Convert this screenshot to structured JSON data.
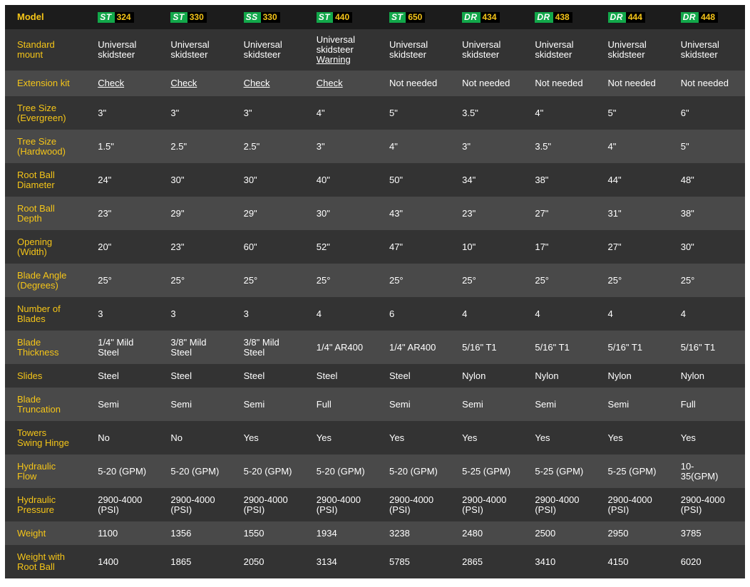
{
  "header_label": "Model",
  "models": [
    {
      "series": "ST",
      "number": "324"
    },
    {
      "series": "ST",
      "number": "330"
    },
    {
      "series": "SS",
      "number": "330"
    },
    {
      "series": "ST",
      "number": "440"
    },
    {
      "series": "ST",
      "number": "650"
    },
    {
      "series": "DR",
      "number": "434"
    },
    {
      "series": "DR",
      "number": "438"
    },
    {
      "series": "DR",
      "number": "444"
    },
    {
      "series": "DR",
      "number": "448"
    }
  ],
  "colors": {
    "accent_yellow": "#f5c518",
    "series_green": "#12a84a",
    "header_bg": "#1c1c1c",
    "row_dark": "#333333",
    "row_light": "#494949"
  },
  "rows": [
    {
      "label": [
        "Standard",
        "mount"
      ],
      "height": 58,
      "cells": [
        {
          "lines": [
            "Universal",
            "skidsteer"
          ]
        },
        {
          "lines": [
            "Universal",
            "skidsteer"
          ]
        },
        {
          "lines": [
            "Universal",
            "skidsteer"
          ]
        },
        {
          "lines": [
            "Universal",
            "skidsteer"
          ],
          "link": "Warning"
        },
        {
          "lines": [
            "Universal",
            "skidsteer"
          ]
        },
        {
          "lines": [
            "Universal",
            "skidsteer"
          ]
        },
        {
          "lines": [
            "Universal",
            "skidsteer"
          ]
        },
        {
          "lines": [
            "Universal",
            "skidsteer"
          ]
        },
        {
          "lines": [
            "Universal",
            "skidsteer"
          ]
        }
      ]
    },
    {
      "label": [
        "Extension kit"
      ],
      "height": 36,
      "cells": [
        {
          "link": "Check"
        },
        {
          "link": "Check"
        },
        {
          "link": "Check"
        },
        {
          "link": "Check"
        },
        {
          "lines": [
            "Not needed"
          ]
        },
        {
          "lines": [
            "Not needed"
          ]
        },
        {
          "lines": [
            "Not needed"
          ]
        },
        {
          "lines": [
            "Not needed"
          ]
        },
        {
          "lines": [
            "Not needed"
          ]
        }
      ]
    },
    {
      "label": [
        "Tree Size",
        "(Evergreen)"
      ],
      "height": 47,
      "cells": [
        {
          "lines": [
            "3\""
          ]
        },
        {
          "lines": [
            "3\""
          ]
        },
        {
          "lines": [
            "3\""
          ]
        },
        {
          "lines": [
            "4\""
          ]
        },
        {
          "lines": [
            "5\""
          ]
        },
        {
          "lines": [
            "3.5\""
          ]
        },
        {
          "lines": [
            "4\""
          ]
        },
        {
          "lines": [
            "5\""
          ]
        },
        {
          "lines": [
            "6\""
          ]
        }
      ]
    },
    {
      "label": [
        "Tree Size",
        "(Hardwood)"
      ],
      "height": 47,
      "cells": [
        {
          "lines": [
            "1.5\""
          ]
        },
        {
          "lines": [
            "2.5\""
          ]
        },
        {
          "lines": [
            "2.5\""
          ]
        },
        {
          "lines": [
            "3\""
          ]
        },
        {
          "lines": [
            "4\""
          ]
        },
        {
          "lines": [
            "3\""
          ]
        },
        {
          "lines": [
            "3.5\""
          ]
        },
        {
          "lines": [
            "4\""
          ]
        },
        {
          "lines": [
            "5\""
          ]
        }
      ]
    },
    {
      "label": [
        "Root Ball",
        "Diameter"
      ],
      "height": 47,
      "cells": [
        {
          "lines": [
            "24\""
          ]
        },
        {
          "lines": [
            "30\""
          ]
        },
        {
          "lines": [
            "30\""
          ]
        },
        {
          "lines": [
            "40\""
          ]
        },
        {
          "lines": [
            "50\""
          ]
        },
        {
          "lines": [
            "34\""
          ]
        },
        {
          "lines": [
            "38\""
          ]
        },
        {
          "lines": [
            "44\""
          ]
        },
        {
          "lines": [
            "48\""
          ]
        }
      ]
    },
    {
      "label": [
        "Root Ball",
        "Depth"
      ],
      "height": 47,
      "cells": [
        {
          "lines": [
            "23\""
          ]
        },
        {
          "lines": [
            "29\""
          ]
        },
        {
          "lines": [
            "29\""
          ]
        },
        {
          "lines": [
            "30\""
          ]
        },
        {
          "lines": [
            "43\""
          ]
        },
        {
          "lines": [
            "23\""
          ]
        },
        {
          "lines": [
            "27\""
          ]
        },
        {
          "lines": [
            "31\""
          ]
        },
        {
          "lines": [
            "38\""
          ]
        }
      ]
    },
    {
      "label": [
        "Opening",
        "(Width)"
      ],
      "height": 47,
      "cells": [
        {
          "lines": [
            "20\""
          ]
        },
        {
          "lines": [
            "23\""
          ]
        },
        {
          "lines": [
            "60\""
          ]
        },
        {
          "lines": [
            "52\""
          ]
        },
        {
          "lines": [
            "47\""
          ]
        },
        {
          "lines": [
            "10\""
          ]
        },
        {
          "lines": [
            "17\""
          ]
        },
        {
          "lines": [
            "27\""
          ]
        },
        {
          "lines": [
            "30\""
          ]
        }
      ]
    },
    {
      "label": [
        "Blade Angle",
        "(Degrees)"
      ],
      "height": 47,
      "cells": [
        {
          "lines": [
            "25°"
          ]
        },
        {
          "lines": [
            "25°"
          ]
        },
        {
          "lines": [
            "25°"
          ]
        },
        {
          "lines": [
            "25°"
          ]
        },
        {
          "lines": [
            "25°"
          ]
        },
        {
          "lines": [
            "25°"
          ]
        },
        {
          "lines": [
            "25°"
          ]
        },
        {
          "lines": [
            "25°"
          ]
        },
        {
          "lines": [
            "25°"
          ]
        }
      ]
    },
    {
      "label": [
        "Number of",
        "Blades"
      ],
      "height": 47,
      "cells": [
        {
          "lines": [
            "3"
          ]
        },
        {
          "lines": [
            "3"
          ]
        },
        {
          "lines": [
            "3"
          ]
        },
        {
          "lines": [
            "4"
          ]
        },
        {
          "lines": [
            "6"
          ]
        },
        {
          "lines": [
            "4"
          ]
        },
        {
          "lines": [
            "4"
          ]
        },
        {
          "lines": [
            "4"
          ]
        },
        {
          "lines": [
            "4"
          ]
        }
      ]
    },
    {
      "label": [
        "Blade",
        "Thickness"
      ],
      "height": 47,
      "cells": [
        {
          "lines": [
            "1/4\" Mild",
            "Steel"
          ]
        },
        {
          "lines": [
            "3/8\" Mild",
            "Steel"
          ]
        },
        {
          "lines": [
            "3/8\" Mild",
            "Steel"
          ]
        },
        {
          "lines": [
            "1/4\" AR400"
          ]
        },
        {
          "lines": [
            "1/4\" AR400"
          ]
        },
        {
          "lines": [
            "5/16\" T1"
          ]
        },
        {
          "lines": [
            "5/16\" T1"
          ]
        },
        {
          "lines": [
            "5/16\" T1"
          ]
        },
        {
          "lines": [
            "5/16\" T1"
          ]
        }
      ]
    },
    {
      "label": [
        "Slides"
      ],
      "height": 33,
      "cells": [
        {
          "lines": [
            "Steel"
          ]
        },
        {
          "lines": [
            "Steel"
          ]
        },
        {
          "lines": [
            "Steel"
          ]
        },
        {
          "lines": [
            "Steel"
          ]
        },
        {
          "lines": [
            "Steel"
          ]
        },
        {
          "lines": [
            "Nylon"
          ]
        },
        {
          "lines": [
            "Nylon"
          ]
        },
        {
          "lines": [
            "Nylon"
          ]
        },
        {
          "lines": [
            "Nylon"
          ]
        }
      ]
    },
    {
      "label": [
        "Blade",
        "Truncation"
      ],
      "height": 47,
      "cells": [
        {
          "lines": [
            "Semi"
          ]
        },
        {
          "lines": [
            "Semi"
          ]
        },
        {
          "lines": [
            "Semi"
          ]
        },
        {
          "lines": [
            "Full"
          ]
        },
        {
          "lines": [
            "Semi"
          ]
        },
        {
          "lines": [
            "Semi"
          ]
        },
        {
          "lines": [
            "Semi"
          ]
        },
        {
          "lines": [
            "Semi"
          ]
        },
        {
          "lines": [
            "Full"
          ]
        }
      ]
    },
    {
      "label": [
        "Towers",
        "Swing Hinge"
      ],
      "height": 47,
      "cells": [
        {
          "lines": [
            "No"
          ]
        },
        {
          "lines": [
            "No"
          ]
        },
        {
          "lines": [
            "Yes"
          ]
        },
        {
          "lines": [
            "Yes"
          ]
        },
        {
          "lines": [
            "Yes"
          ]
        },
        {
          "lines": [
            "Yes"
          ]
        },
        {
          "lines": [
            "Yes"
          ]
        },
        {
          "lines": [
            "Yes"
          ]
        },
        {
          "lines": [
            "Yes"
          ]
        }
      ]
    },
    {
      "label": [
        "Hydraulic",
        "Flow"
      ],
      "height": 47,
      "cells": [
        {
          "lines": [
            "5-20 (GPM)"
          ]
        },
        {
          "lines": [
            "5-20 (GPM)"
          ]
        },
        {
          "lines": [
            "5-20 (GPM)"
          ]
        },
        {
          "lines": [
            "5-20 (GPM)"
          ]
        },
        {
          "lines": [
            "5-20 (GPM)"
          ]
        },
        {
          "lines": [
            "5-25 (GPM)"
          ]
        },
        {
          "lines": [
            "5-25 (GPM)"
          ]
        },
        {
          "lines": [
            "5-25 (GPM)"
          ]
        },
        {
          "lines": [
            "10-",
            "35(GPM)"
          ]
        }
      ]
    },
    {
      "label": [
        "Hydraulic",
        "Pressure"
      ],
      "height": 47,
      "cells": [
        {
          "lines": [
            "2900-4000",
            "(PSI)"
          ]
        },
        {
          "lines": [
            "2900-4000",
            "(PSI)"
          ]
        },
        {
          "lines": [
            "2900-4000",
            "(PSI)"
          ]
        },
        {
          "lines": [
            "2900-4000",
            "(PSI)"
          ]
        },
        {
          "lines": [
            "2900-4000",
            "(PSI)"
          ]
        },
        {
          "lines": [
            "2900-4000",
            "(PSI)"
          ]
        },
        {
          "lines": [
            "2900-4000",
            "(PSI)"
          ]
        },
        {
          "lines": [
            "2900-4000",
            "(PSI)"
          ]
        },
        {
          "lines": [
            "2900-4000",
            "(PSI)"
          ]
        }
      ]
    },
    {
      "label": [
        "Weight"
      ],
      "height": 33,
      "cells": [
        {
          "lines": [
            "1100"
          ]
        },
        {
          "lines": [
            "1356"
          ]
        },
        {
          "lines": [
            "1550"
          ]
        },
        {
          "lines": [
            "1934"
          ]
        },
        {
          "lines": [
            "3238"
          ]
        },
        {
          "lines": [
            "2480"
          ]
        },
        {
          "lines": [
            "2500"
          ]
        },
        {
          "lines": [
            "2950"
          ]
        },
        {
          "lines": [
            "3785"
          ]
        }
      ]
    },
    {
      "label": [
        "Weight with",
        "Root Ball"
      ],
      "height": 47,
      "cells": [
        {
          "lines": [
            "1400"
          ]
        },
        {
          "lines": [
            "1865"
          ]
        },
        {
          "lines": [
            "2050"
          ]
        },
        {
          "lines": [
            "3134"
          ]
        },
        {
          "lines": [
            "5785"
          ]
        },
        {
          "lines": [
            "2865"
          ]
        },
        {
          "lines": [
            "3410"
          ]
        },
        {
          "lines": [
            "4150"
          ]
        },
        {
          "lines": [
            "6020"
          ]
        }
      ]
    }
  ]
}
